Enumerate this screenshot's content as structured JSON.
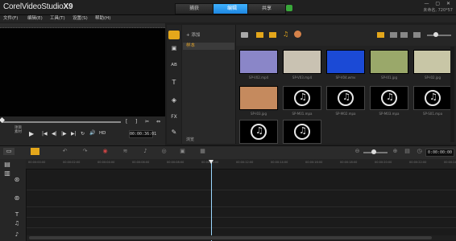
{
  "app": {
    "brand": "Corel",
    "product": "VideoStudio",
    "version": "X9"
  },
  "step_tabs": [
    "捕获",
    "编辑",
    "共享"
  ],
  "active_tab": "编辑",
  "window_controls": "— ▢ ✕",
  "project_info": "未命名, 720*57",
  "menu": [
    "文件(F)",
    "编辑(E)",
    "工具(T)",
    "设置(S)",
    "帮助(H)"
  ],
  "player": {
    "clip_label": "项目",
    "clip_sublabel": "素材",
    "timecode": "00:00:36:01",
    "hd_label": "HD",
    "controls": [
      "▶",
      "|◀",
      "◀|",
      "|▶",
      "▶|",
      "↻",
      "🔊"
    ],
    "marks": [
      "[",
      "]",
      "✂",
      "⇔"
    ]
  },
  "library": {
    "add_label": "添加",
    "folder_name": "样本",
    "browse_label": "浏览",
    "tools": [
      "▤",
      "▣",
      "AB",
      "T",
      "◈",
      "FX",
      "✎"
    ],
    "items": [
      {
        "caption": "SP-V02.mp4",
        "kind": "video",
        "color": "#8a86c8"
      },
      {
        "caption": "SP-V03.mp4",
        "kind": "video",
        "color": "#c9c2b2"
      },
      {
        "caption": "SP-V04.wmv",
        "kind": "video",
        "color": "#1b4ad6"
      },
      {
        "caption": "SP-I01.jpg",
        "kind": "image",
        "color": "#9aa86a"
      },
      {
        "caption": "SP-I02.jpg",
        "kind": "image",
        "color": "#c8c6a6"
      },
      {
        "caption": "SP-I03.jpg",
        "kind": "image",
        "color": "#c58a5e"
      },
      {
        "caption": "SP-M01.mpa",
        "kind": "audio",
        "color": "#000000"
      },
      {
        "caption": "SP-M02.mpa",
        "kind": "audio",
        "color": "#000000"
      },
      {
        "caption": "SP-M03.mpa",
        "kind": "audio",
        "color": "#000000"
      },
      {
        "caption": "SP-S01.mpa",
        "kind": "audio",
        "color": "#000000"
      },
      {
        "caption": "",
        "kind": "audio",
        "color": "#000000"
      },
      {
        "caption": "",
        "kind": "audio",
        "color": "#000000"
      }
    ]
  },
  "timeline": {
    "timecode": "0:00:00:00",
    "ruler": [
      "00:00:00:00",
      "00:00:02:00",
      "00:00:04:00",
      "00:00:06:00",
      "00:00:08:00",
      "00:00:10:00",
      "00:00:12:00",
      "00:00:14:00",
      "00:00:16:00",
      "00:00:18:00",
      "00:00:20:00",
      "00:00:22:00",
      "00:00:24:00"
    ]
  },
  "colors": {
    "accent_blue": "#1e86e0",
    "media_orange": "#e4a71b",
    "playhead": "#9bd8ff"
  }
}
